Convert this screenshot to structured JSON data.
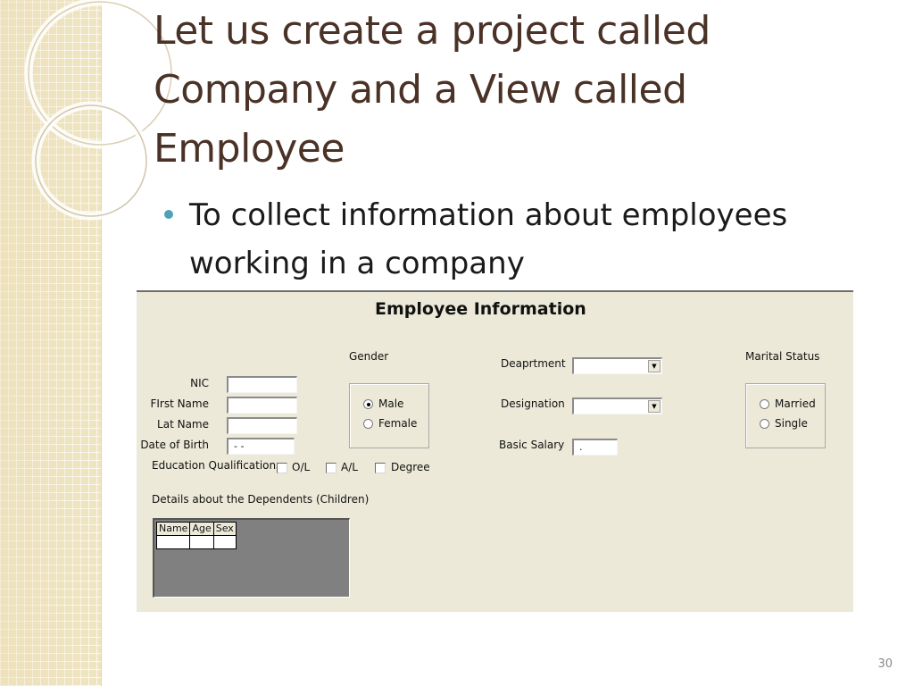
{
  "slide": {
    "title_lines": [
      "Let us create a project called",
      "Company and a View called",
      "Employee"
    ],
    "bullet": {
      "lines": [
        "To collect information about employees",
        "working in a company"
      ]
    },
    "page_number": "30"
  },
  "form": {
    "title": "Employee Information",
    "labels": {
      "nic": "NIC",
      "first_name": "FIrst Name",
      "last_name": "Lat Name",
      "dob": "Date of Birth",
      "education": "Education Qualifications",
      "dependents": "Details about the Dependents (Children)",
      "gender": "Gender",
      "department": "Deaprtment",
      "designation": "Designation",
      "basic_salary": "Basic Salary",
      "marital_status": "Marital Status"
    },
    "fields": {
      "nic": "",
      "first_name": "",
      "last_name": "",
      "dob": "- -",
      "department": "",
      "designation": "",
      "basic_salary": "."
    },
    "gender_options": [
      {
        "label": "Male",
        "selected": true
      },
      {
        "label": "Female",
        "selected": false
      }
    ],
    "marital_options": [
      {
        "label": "Married",
        "selected": false
      },
      {
        "label": "Single",
        "selected": false
      }
    ],
    "education_options": [
      {
        "label": "O/L",
        "checked": false
      },
      {
        "label": "A/L",
        "checked": false
      },
      {
        "label": "Degree",
        "checked": false
      }
    ],
    "dependents_grid": {
      "columns": [
        "Name",
        "Age",
        "Sex"
      ],
      "rows": [
        [
          "",
          "",
          ""
        ]
      ]
    }
  },
  "colors": {
    "title": "#4a3227",
    "bullet": "#4fa1b5",
    "form_background": "#ece9d8",
    "side_band": "#efe4c0",
    "grid_background": "#808080"
  }
}
